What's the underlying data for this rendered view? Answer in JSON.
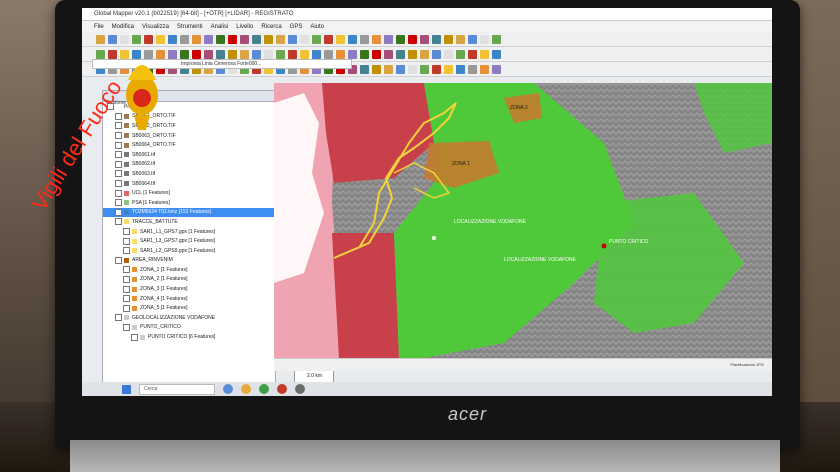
{
  "photo": {
    "laptop_brand": "acer",
    "watermark_text": "Vigili del Fuoco"
  },
  "app": {
    "title": "Global Mapper v20.1 (b022519) [64-bit] - [+OTR] [+LIDAR] - REGISTRATO",
    "menu": [
      "File",
      "Modifica",
      "Visualizza",
      "Strumenti",
      "Analisi",
      "Livello",
      "Ricerca",
      "GPS",
      "Aiuto"
    ],
    "search_value": "Impronta Linia Cenerosa Forte000...",
    "toolbar_colors": [
      "#d9a441",
      "#5b8bd6",
      "#e0e0e0",
      "#6aa84f",
      "#c0392b",
      "#f1c232",
      "#3d85c6",
      "#999999",
      "#e69138",
      "#8e7cc3",
      "#38761d",
      "#cc0000",
      "#a64d79",
      "#45818e",
      "#bf9000"
    ],
    "status_right": "Pianificazione.JPG"
  },
  "layers": {
    "header": "Gestione livelli",
    "items": [
      {
        "label": "Progetto",
        "indent": 0,
        "color": "#ffffff"
      },
      {
        "label": "SB0061_ORTO.TIF",
        "indent": 1,
        "color": "#9b7b55"
      },
      {
        "label": "SB0062_ORTO.TIF",
        "indent": 1,
        "color": "#9b7b55"
      },
      {
        "label": "SB0063_ORTO.TIF",
        "indent": 1,
        "color": "#9b7b55"
      },
      {
        "label": "SB0064_ORTO.TIF",
        "indent": 1,
        "color": "#9b7b55"
      },
      {
        "label": "SB0061.tif",
        "indent": 1,
        "color": "#777777"
      },
      {
        "label": "SB0062.tif",
        "indent": 1,
        "color": "#777777"
      },
      {
        "label": "SB0063.tif",
        "indent": 1,
        "color": "#777777"
      },
      {
        "label": "SB0064.tif",
        "indent": 1,
        "color": "#777777"
      },
      {
        "label": "UCL [1 Features]",
        "indent": 1,
        "color": "#e06666"
      },
      {
        "label": "PSA [1 Features]",
        "indent": 1,
        "color": "#93c47d"
      },
      {
        "label": "TO2M5624 T02.kmz [152 Features]",
        "indent": 1,
        "color": "#3d85c6",
        "selected": true
      },
      {
        "label": "TRACCE_BATTUTE",
        "indent": 1,
        "color": "#ffd966"
      },
      {
        "label": "SAR1_L1_GPS7.gpx [1 Features]",
        "indent": 2,
        "color": "#ffd966"
      },
      {
        "label": "SAR1_L3_GPS7.gpx [1 Features]",
        "indent": 2,
        "color": "#ffd966"
      },
      {
        "label": "SAR1_L2_GPS9.gpx [1 Features]",
        "indent": 2,
        "color": "#ffd966"
      },
      {
        "label": "AREA_RINVENIM",
        "indent": 1,
        "color": "#b45f06"
      },
      {
        "label": "ZONA_1 [1 Features]",
        "indent": 2,
        "color": "#e69138"
      },
      {
        "label": "ZONA_2 [1 Features]",
        "indent": 2,
        "color": "#e69138"
      },
      {
        "label": "ZONA_3 [1 Features]",
        "indent": 2,
        "color": "#e69138"
      },
      {
        "label": "ZONA_4 [1 Features]",
        "indent": 2,
        "color": "#e69138"
      },
      {
        "label": "ZONA_5 [1 Features]",
        "indent": 2,
        "color": "#e69138"
      },
      {
        "label": "GEOLOCALIZZAZIONE VODAFONE",
        "indent": 1,
        "color": "#cccccc"
      },
      {
        "label": "PUNTO_CRITICO",
        "indent": 2,
        "color": "#cccccc"
      },
      {
        "label": "PUNTO CRITICO [6 Features]",
        "indent": 3,
        "color": "#cccccc"
      }
    ]
  },
  "map": {
    "labels": [
      {
        "text": "LOCALIZZAZIONE VODAFONE"
      },
      {
        "text": "LOCALIZZAZIONE VODAFONE"
      },
      {
        "text": "PUNTO CRITICO"
      },
      {
        "text": "ZONA 1"
      },
      {
        "text": "ZONA 2"
      }
    ],
    "scale_label": "2.0 km",
    "colors": {
      "green": "#4fc93a",
      "red": "#c8404a",
      "pink": "#f0a3b0",
      "gray": "#8c8c8c",
      "orange": "#c9772c",
      "yellow": "#f4d23a"
    }
  },
  "taskbar": {
    "search_placeholder": "Cerca"
  }
}
